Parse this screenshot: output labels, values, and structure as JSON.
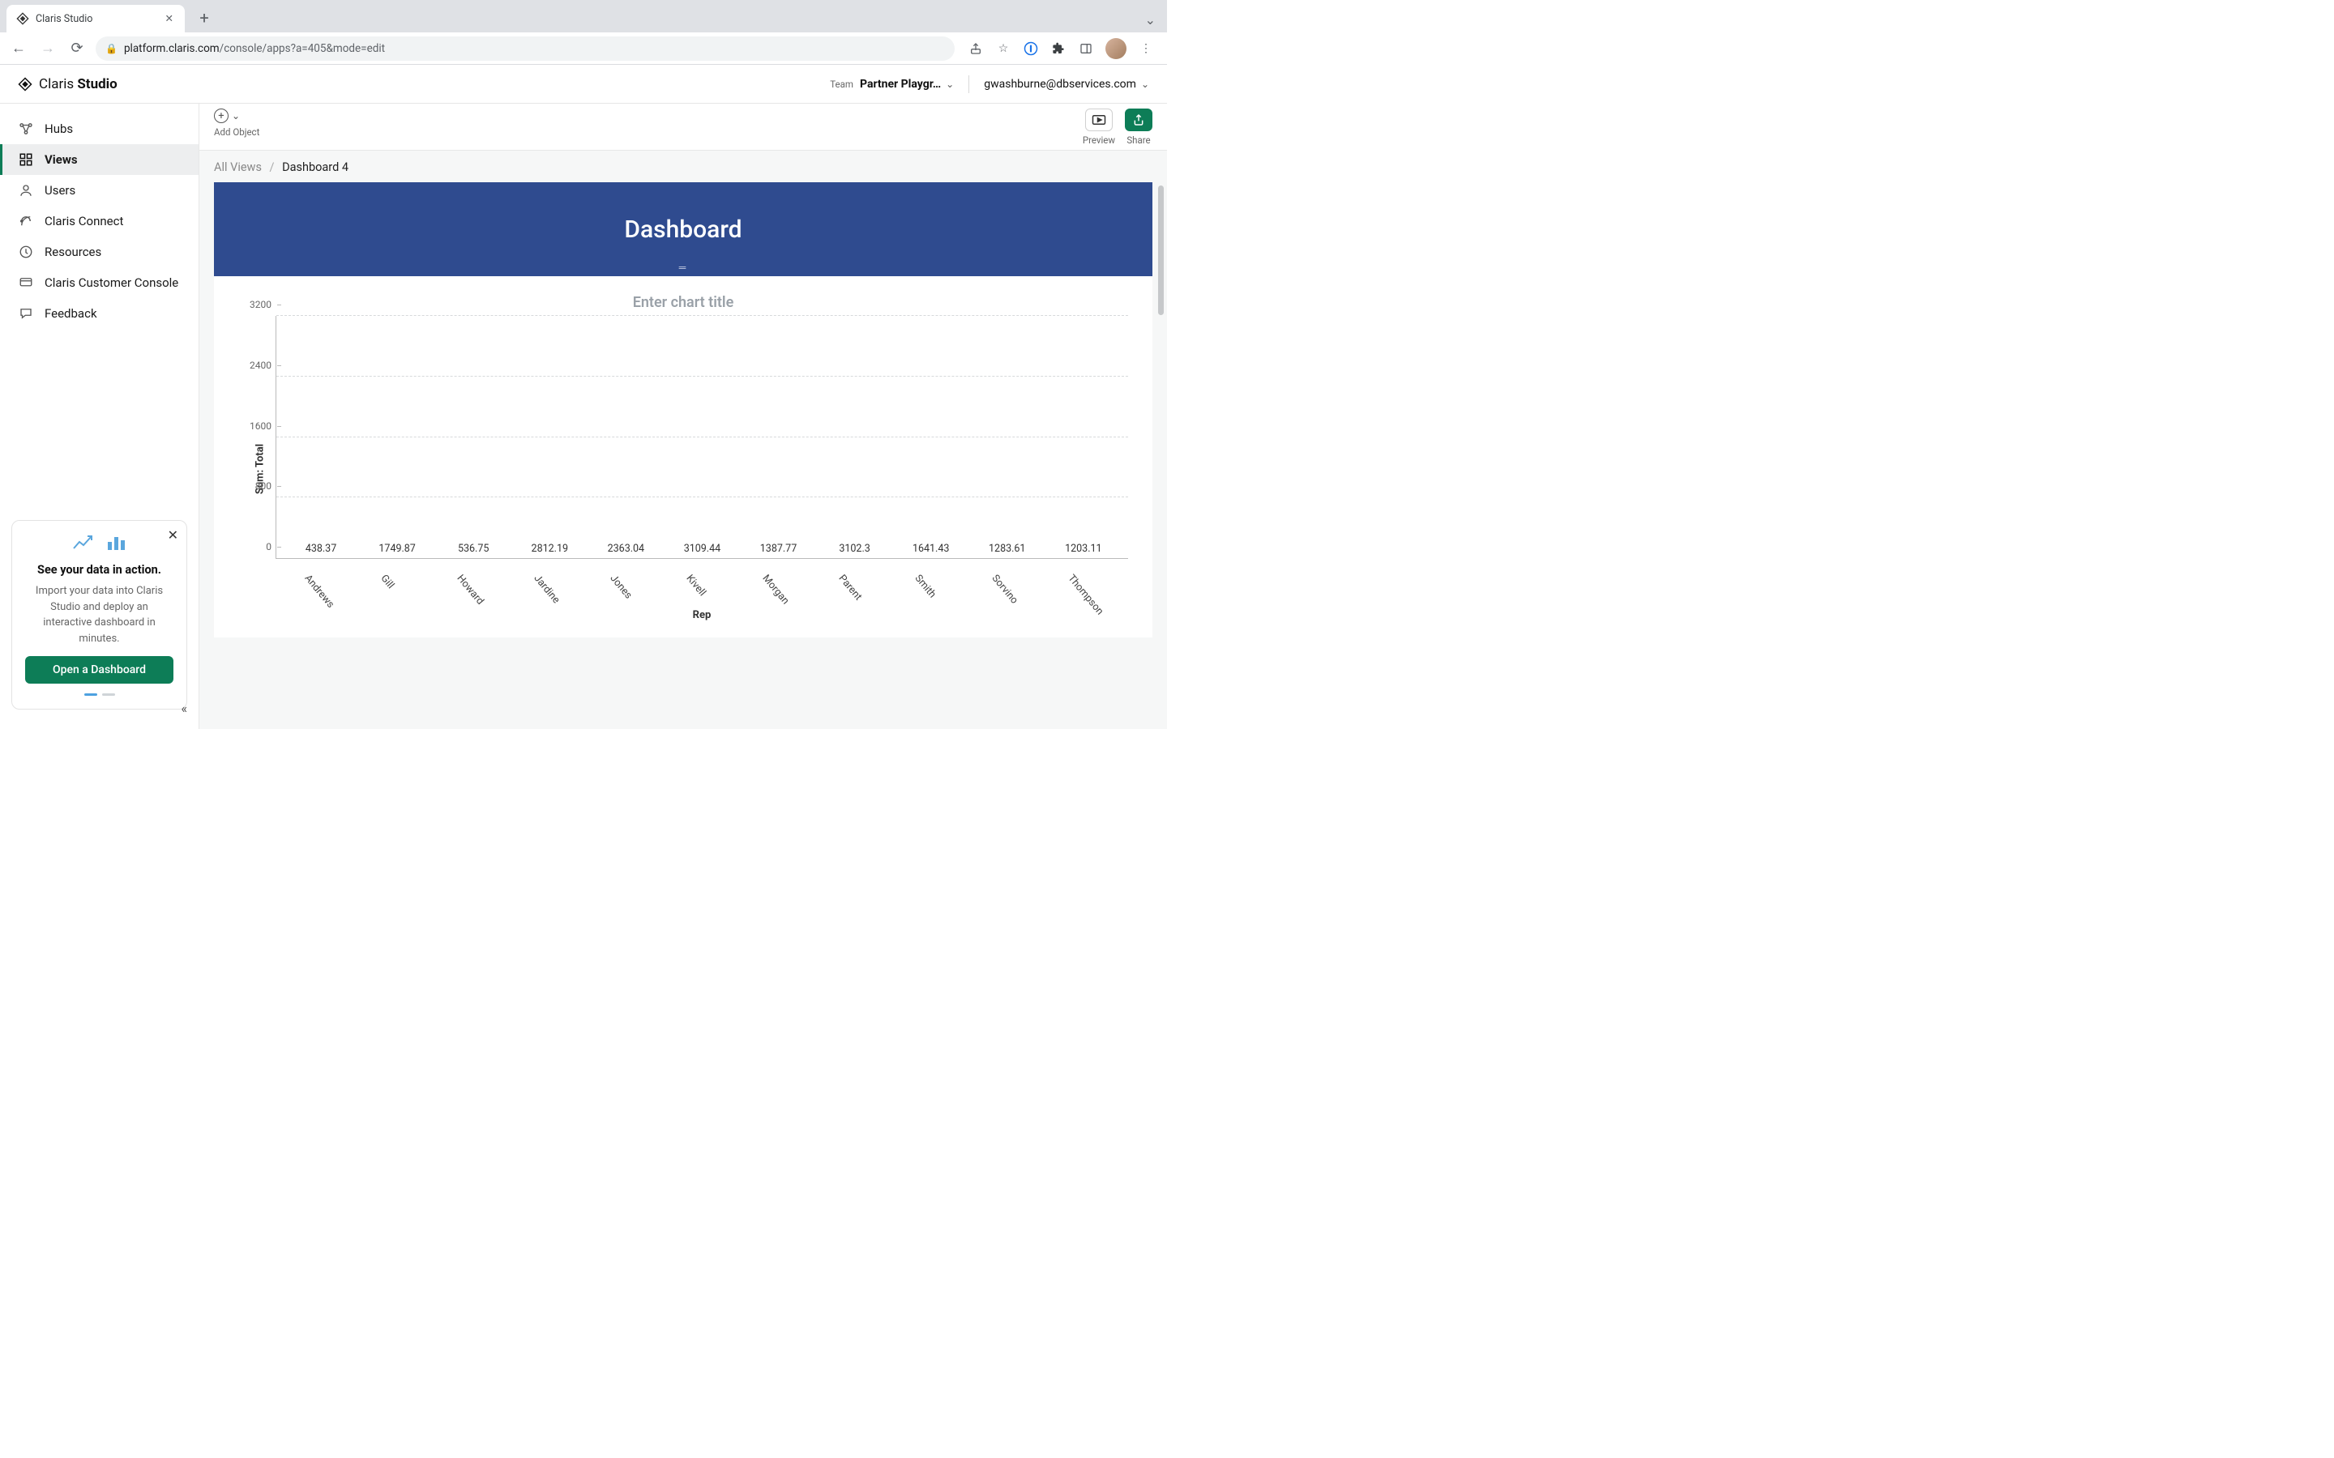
{
  "browser": {
    "tab_title": "Claris Studio",
    "url_host": "platform.claris.com",
    "url_path": "/console/apps?a=405&mode=edit"
  },
  "header": {
    "brand": "Claris",
    "product": "Studio",
    "team_label": "Team",
    "team_name": "Partner Playgr…",
    "user": "gwashburne@dbservices.com"
  },
  "sidebar": {
    "items": [
      {
        "label": "Hubs",
        "icon": "hubs-icon"
      },
      {
        "label": "Views",
        "icon": "views-icon",
        "active": true
      },
      {
        "label": "Users",
        "icon": "users-icon"
      },
      {
        "label": "Claris Connect",
        "icon": "connect-icon"
      },
      {
        "label": "Resources",
        "icon": "resources-icon"
      },
      {
        "label": "Claris Customer Console",
        "icon": "console-icon"
      },
      {
        "label": "Feedback",
        "icon": "feedback-icon"
      }
    ],
    "promo": {
      "title": "See your data in action.",
      "body": "Import your data into Claris Studio and deploy an interactive dashboard in minutes.",
      "cta": "Open a Dashboard"
    }
  },
  "toolbar": {
    "add_object_label": "Add Object",
    "preview_label": "Preview",
    "share_label": "Share"
  },
  "breadcrumb": {
    "root": "All Views",
    "current": "Dashboard 4"
  },
  "banner": {
    "title": "Dashboard"
  },
  "chart_data": {
    "type": "bar",
    "title_placeholder": "Enter chart title",
    "xlabel": "Rep",
    "ylabel": "Sum: Total",
    "ylim": [
      0,
      3200
    ],
    "y_ticks": [
      0,
      800,
      1600,
      2400,
      3200
    ],
    "categories": [
      "Andrews",
      "Gill",
      "Howard",
      "Jardine",
      "Jones",
      "Kivell",
      "Morgan",
      "Parent",
      "Smith",
      "Sorvino",
      "Thompson"
    ],
    "values": [
      438.37,
      1749.87,
      536.75,
      2812.19,
      2363.04,
      3109.44,
      1387.77,
      3102.3,
      1641.43,
      1283.61,
      1203.11
    ],
    "colors": [
      "#ef6a6a",
      "#54c1bd",
      "#f4a340",
      "#63bf63",
      "#a071d8",
      "#f5cd4c",
      "#ef6a6a",
      "#7cc4ea",
      "#63bf63",
      "#b59874",
      "#54c1bd"
    ]
  }
}
